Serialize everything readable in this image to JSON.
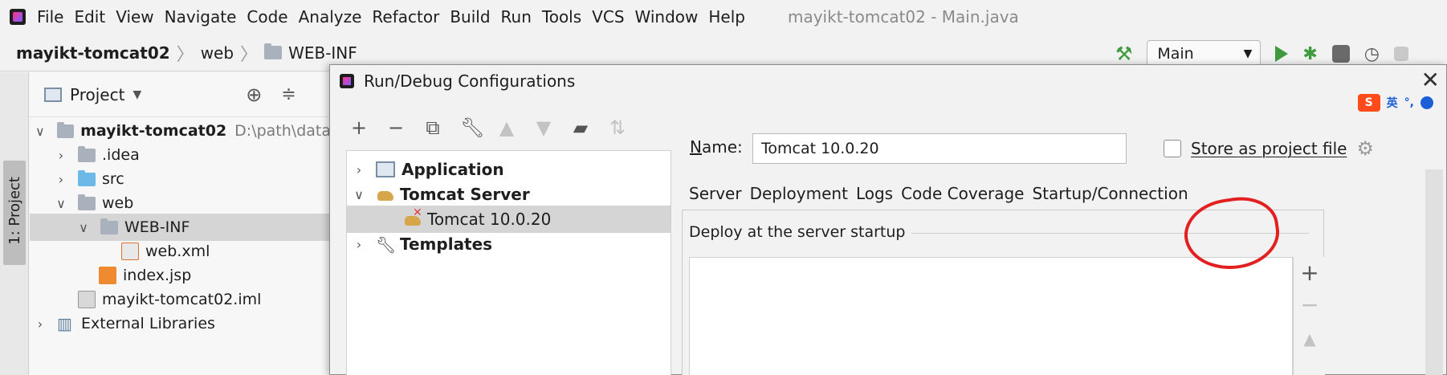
{
  "menu": {
    "items": [
      "File",
      "Edit",
      "View",
      "Navigate",
      "Code",
      "Analyze",
      "Refactor",
      "Build",
      "Run",
      "Tools",
      "VCS",
      "Window",
      "Help"
    ],
    "window_title": "mayikt-tomcat02 - Main.java"
  },
  "navbar": {
    "project": "mayikt-tomcat02",
    "crumb1": "web",
    "crumb2": "WEB-INF",
    "run_config": "Main"
  },
  "sidestrip": {
    "project_tab": "1: Project"
  },
  "project_panel": {
    "title": "Project",
    "tree": [
      {
        "label": "mayikt-tomcat02",
        "path": "D:\\path\\data",
        "indent": 0,
        "expanded": true
      },
      {
        "label": ".idea",
        "indent": 1
      },
      {
        "label": "src",
        "indent": 1
      },
      {
        "label": "web",
        "indent": 1,
        "expanded": true
      },
      {
        "label": "WEB-INF",
        "indent": 2,
        "expanded": true,
        "selected": true
      },
      {
        "label": "web.xml",
        "indent": 3
      },
      {
        "label": "index.jsp",
        "indent": 2
      },
      {
        "label": "mayikt-tomcat02.iml",
        "indent": 1
      },
      {
        "label": "External Libraries",
        "indent": 0
      }
    ]
  },
  "dialog": {
    "title": "Run/Debug Configurations",
    "ime_label": "英",
    "ime_punct": "°,",
    "tree": [
      {
        "label": "Application",
        "bold": true
      },
      {
        "label": "Tomcat Server",
        "bold": true
      },
      {
        "label": "Tomcat 10.0.20",
        "bold": false,
        "selected": true
      },
      {
        "label": "Templates",
        "bold": true
      }
    ],
    "name_label_underlined": "N",
    "name_label_rest": "ame:",
    "name_value": "Tomcat 10.0.20",
    "store_label": "Store as project file",
    "tabs": [
      "Server",
      "Deployment",
      "Logs",
      "Code Coverage",
      "Startup/Connection"
    ],
    "active_tab": "Deployment",
    "deploy_section_label": "Deploy at the server startup",
    "side_buttons": [
      "+",
      "−",
      "▲"
    ]
  }
}
